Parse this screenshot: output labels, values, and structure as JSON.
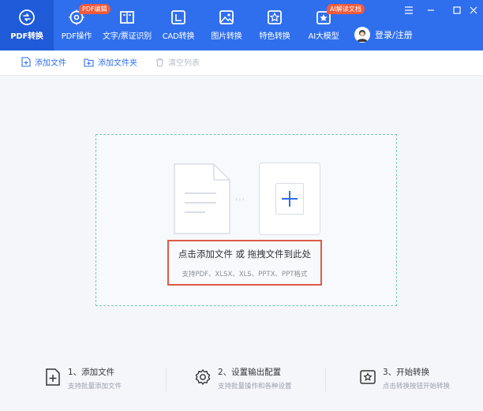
{
  "nav": {
    "items": [
      {
        "label": "PDF转换",
        "icon": "pdf-convert-icon",
        "active": true
      },
      {
        "label": "PDF操作",
        "icon": "pdf-operation-icon",
        "badge": "PDF编辑"
      },
      {
        "label": "文字/票证识别",
        "icon": "text-recognition-icon"
      },
      {
        "label": "CAD转换",
        "icon": "cad-convert-icon"
      },
      {
        "label": "图片转换",
        "icon": "image-convert-icon"
      },
      {
        "label": "特色转换",
        "icon": "special-convert-icon"
      },
      {
        "label": "AI大模型",
        "icon": "ai-model-icon",
        "badge": "AI解读文档"
      }
    ],
    "login_label": "登录/注册"
  },
  "toolbar": {
    "add_file": "添加文件",
    "add_folder": "添加文件夹",
    "clear_list": "清空列表"
  },
  "dropzone": {
    "main_text": "点击添加文件 或 拖拽文件到此处",
    "sub_text": "支持PDF、XLSX、XLS、PPTX、PPT格式"
  },
  "steps": [
    {
      "title": "1、添加文件",
      "desc": "支持批量添加文件",
      "icon": "add-file-icon"
    },
    {
      "title": "2、设置输出配置",
      "desc": "支持批量操作和各种设置",
      "icon": "settings-gear-icon"
    },
    {
      "title": "3、开始转换",
      "desc": "点击转换按钮开始转换",
      "icon": "start-convert-icon"
    }
  ],
  "colors": {
    "brand": "#2f6fee",
    "badge": "#f25b3a",
    "highlight": "#e05a45",
    "dashed_border": "#7cc7b6"
  }
}
